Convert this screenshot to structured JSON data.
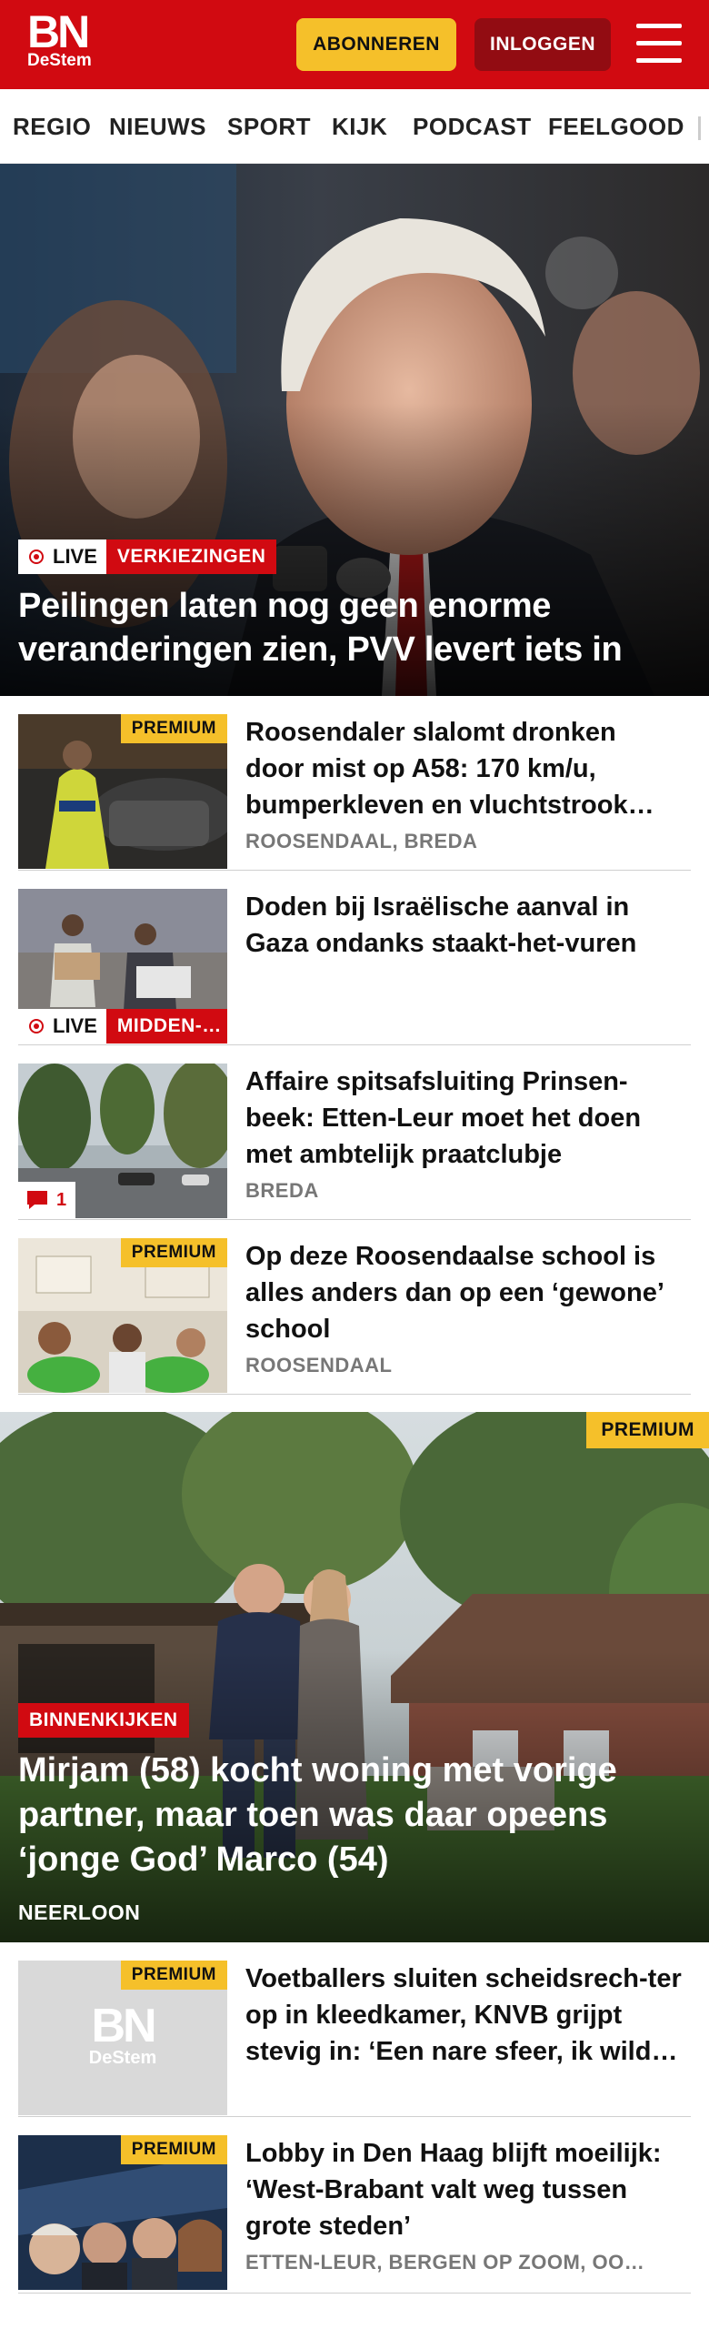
{
  "header": {
    "logo_main": "BN",
    "logo_sub": "DeStem",
    "subscribe_label": "ABONNEREN",
    "login_label": "INLOGGEN"
  },
  "nav": {
    "items": [
      "REGIO",
      "NIEUWS",
      "SPORT",
      "KIJK",
      "PODCAST",
      "FEELGOOD"
    ]
  },
  "hero": {
    "live_label": "LIVE",
    "category": "VERKIEZINGEN",
    "title": "Peilingen laten nog geen enorme veranderingen zien, PVV levert iets in"
  },
  "articles": [
    {
      "premium": "PREMIUM",
      "title": "Roosendaler slalomt dronken door mist op A58: 170 km/u, bumperkleven en vluchtstrook…",
      "location": "ROOSENDAAL, BREDA"
    },
    {
      "live_label": "LIVE",
      "category": "MIDDEN-…",
      "title": "Doden bij Israëlische aanval in Gaza ondanks staakt-het-vuren"
    },
    {
      "comments": "1",
      "title": "Affaire spitsafsluiting Prinsen-beek: Etten-Leur moet het doen met ambtelijk praatclubje",
      "location": "BREDA"
    },
    {
      "premium": "PREMIUM",
      "title": "Op deze Roosendaalse school is alles anders dan op een ‘gewone’ school",
      "location": "ROOSENDAAL"
    }
  ],
  "feature": {
    "premium": "PREMIUM",
    "category": "BINNENKIJKEN",
    "title": "Mirjam (58) kocht woning met vorige partner, maar toen was daar opeens ‘jonge God’ Marco (54)",
    "location": "NEERLOON"
  },
  "articles2": [
    {
      "premium": "PREMIUM",
      "placeholder_logo": "BN",
      "placeholder_sub": "DeStem",
      "title": "Voetballers sluiten scheidsrech-ter op in kleedkamer, KNVB grijpt stevig in: ‘Een nare sfeer, ik wild…"
    },
    {
      "premium": "PREMIUM",
      "title": "Lobby in Den Haag blijft moeilijk: ‘West-Brabant valt weg tussen grote steden’",
      "location": "ETTEN-LEUR, BERGEN OP ZOOM, OO…"
    }
  ],
  "colors": {
    "brand_red": "#d10a11",
    "premium_yellow": "#f5c02a",
    "login_dark_red": "#920c12"
  }
}
